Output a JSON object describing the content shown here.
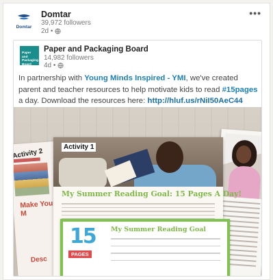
{
  "outer_post": {
    "company": "Domtar",
    "followers": "39,972 followers",
    "age": "2d •",
    "logo_text": "Domtar",
    "more_label": "•••"
  },
  "shared_post": {
    "company": "Paper and Packaging Board",
    "followers": "14,982 followers",
    "age": "4d •",
    "logo_text": "Paper and Packaging Board",
    "text_part1": "In partnership with ",
    "link_ymi": "Young Minds Inspired - YMI",
    "text_part2": ", we've created parent and teacher resources to help motivate kids to read ",
    "hashtag": "#15pages",
    "text_part3": " a day. Download the resources here: ",
    "url": "http://hluf.us/rNiI50AeC44"
  },
  "image": {
    "activity1": "Activity 1",
    "activity2": "Activity 2",
    "make_your": "Make Your M",
    "desc_fragment": "Desc",
    "main_heading": "My Summer Reading Goal: 15 Pages A Day!",
    "cert_heading": "My Summer Reading Goal",
    "cert_number": "15",
    "cert_pages": "PAGES"
  },
  "colors": {
    "link": "#1d7fb6",
    "logo_teal": "#1a8e8c",
    "goal_green": "#7fb84a"
  }
}
